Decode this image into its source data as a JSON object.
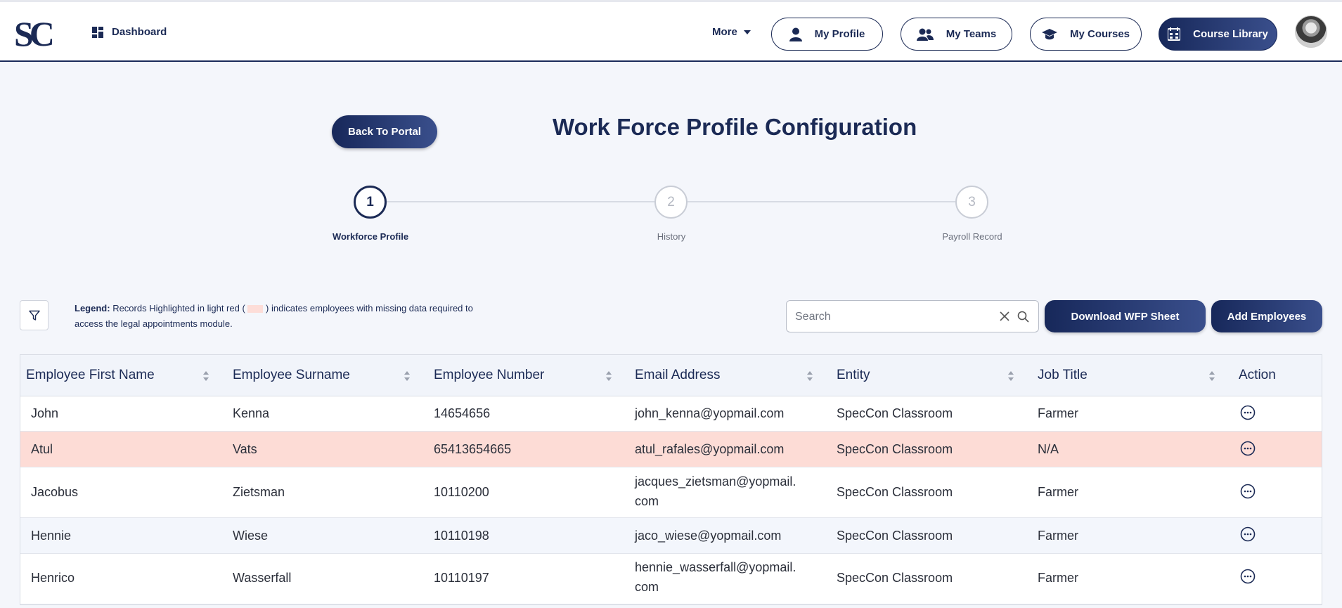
{
  "nav": {
    "logo_text": "SC",
    "dashboard": "Dashboard",
    "more": "More",
    "my_profile": "My Profile",
    "my_teams": "My Teams",
    "my_courses": "My Courses",
    "course_library": "Course Library"
  },
  "page": {
    "back_button": "Back To Portal",
    "title": "Work Force Profile Configuration"
  },
  "steps": [
    {
      "number": "1",
      "label": "Workforce Profile",
      "active": true
    },
    {
      "number": "2",
      "label": "History",
      "active": false
    },
    {
      "number": "3",
      "label": "Payroll Record",
      "active": false
    }
  ],
  "legend": {
    "title": "Legend:",
    "text_before": "Records Highlighted in light red (",
    "text_after": ") indicates employees with missing data required to access the legal appointments module.",
    "highlight_color": "#fddcd6"
  },
  "search": {
    "placeholder": "Search",
    "value": ""
  },
  "actions": {
    "download": "Download WFP Sheet",
    "add": "Add Employees"
  },
  "table": {
    "columns": [
      "Employee First Name",
      "Employee Surname",
      "Employee Number",
      "Email Address",
      "Entity",
      "Job Title",
      "Action"
    ],
    "rows": [
      {
        "first": "John",
        "surname": "Kenna",
        "number": "14654656",
        "email_1": "john_kenna@yopmail.com",
        "email_2": "",
        "entity": "SpecCon Classroom",
        "job": "Farmer",
        "highlight": false
      },
      {
        "first": "Atul",
        "surname": "Vats",
        "number": "65413654665",
        "email_1": "atul_rafales@yopmail.com",
        "email_2": "",
        "entity": "SpecCon Classroom",
        "job": "N/A",
        "highlight": true
      },
      {
        "first": "Jacobus",
        "surname": "Zietsman",
        "number": "10110200",
        "email_1": "jacques_zietsman@yopmail.",
        "email_2": "com",
        "entity": "SpecCon Classroom",
        "job": "Farmer",
        "highlight": false
      },
      {
        "first": "Hennie",
        "surname": "Wiese",
        "number": "10110198",
        "email_1": "jaco_wiese@yopmail.com",
        "email_2": "",
        "entity": "SpecCon Classroom",
        "job": "Farmer",
        "highlight": false
      },
      {
        "first": "Henrico",
        "surname": "Wasserfall",
        "number": "10110197",
        "email_1": "hennie_wasserfall@yopmail.",
        "email_2": "com",
        "entity": "SpecCon Classroom",
        "job": "Farmer",
        "highlight": false
      }
    ]
  },
  "colors": {
    "brand": "#1b2a55",
    "highlight": "#fddcd6"
  }
}
